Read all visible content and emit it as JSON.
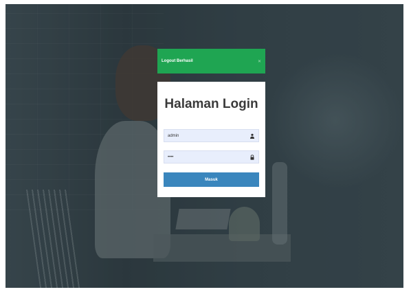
{
  "header": {
    "title": "Logout Berhasil",
    "close_icon": "close-icon"
  },
  "login": {
    "title": "Halaman Login",
    "username": {
      "value": "admin",
      "icon": "user-icon"
    },
    "password": {
      "value": "••••",
      "icon": "lock-icon"
    },
    "submit_label": "Masuk"
  },
  "colors": {
    "header_bg": "#1fa552",
    "button_bg": "#3a86bd",
    "field_bg": "#e8eefc"
  }
}
